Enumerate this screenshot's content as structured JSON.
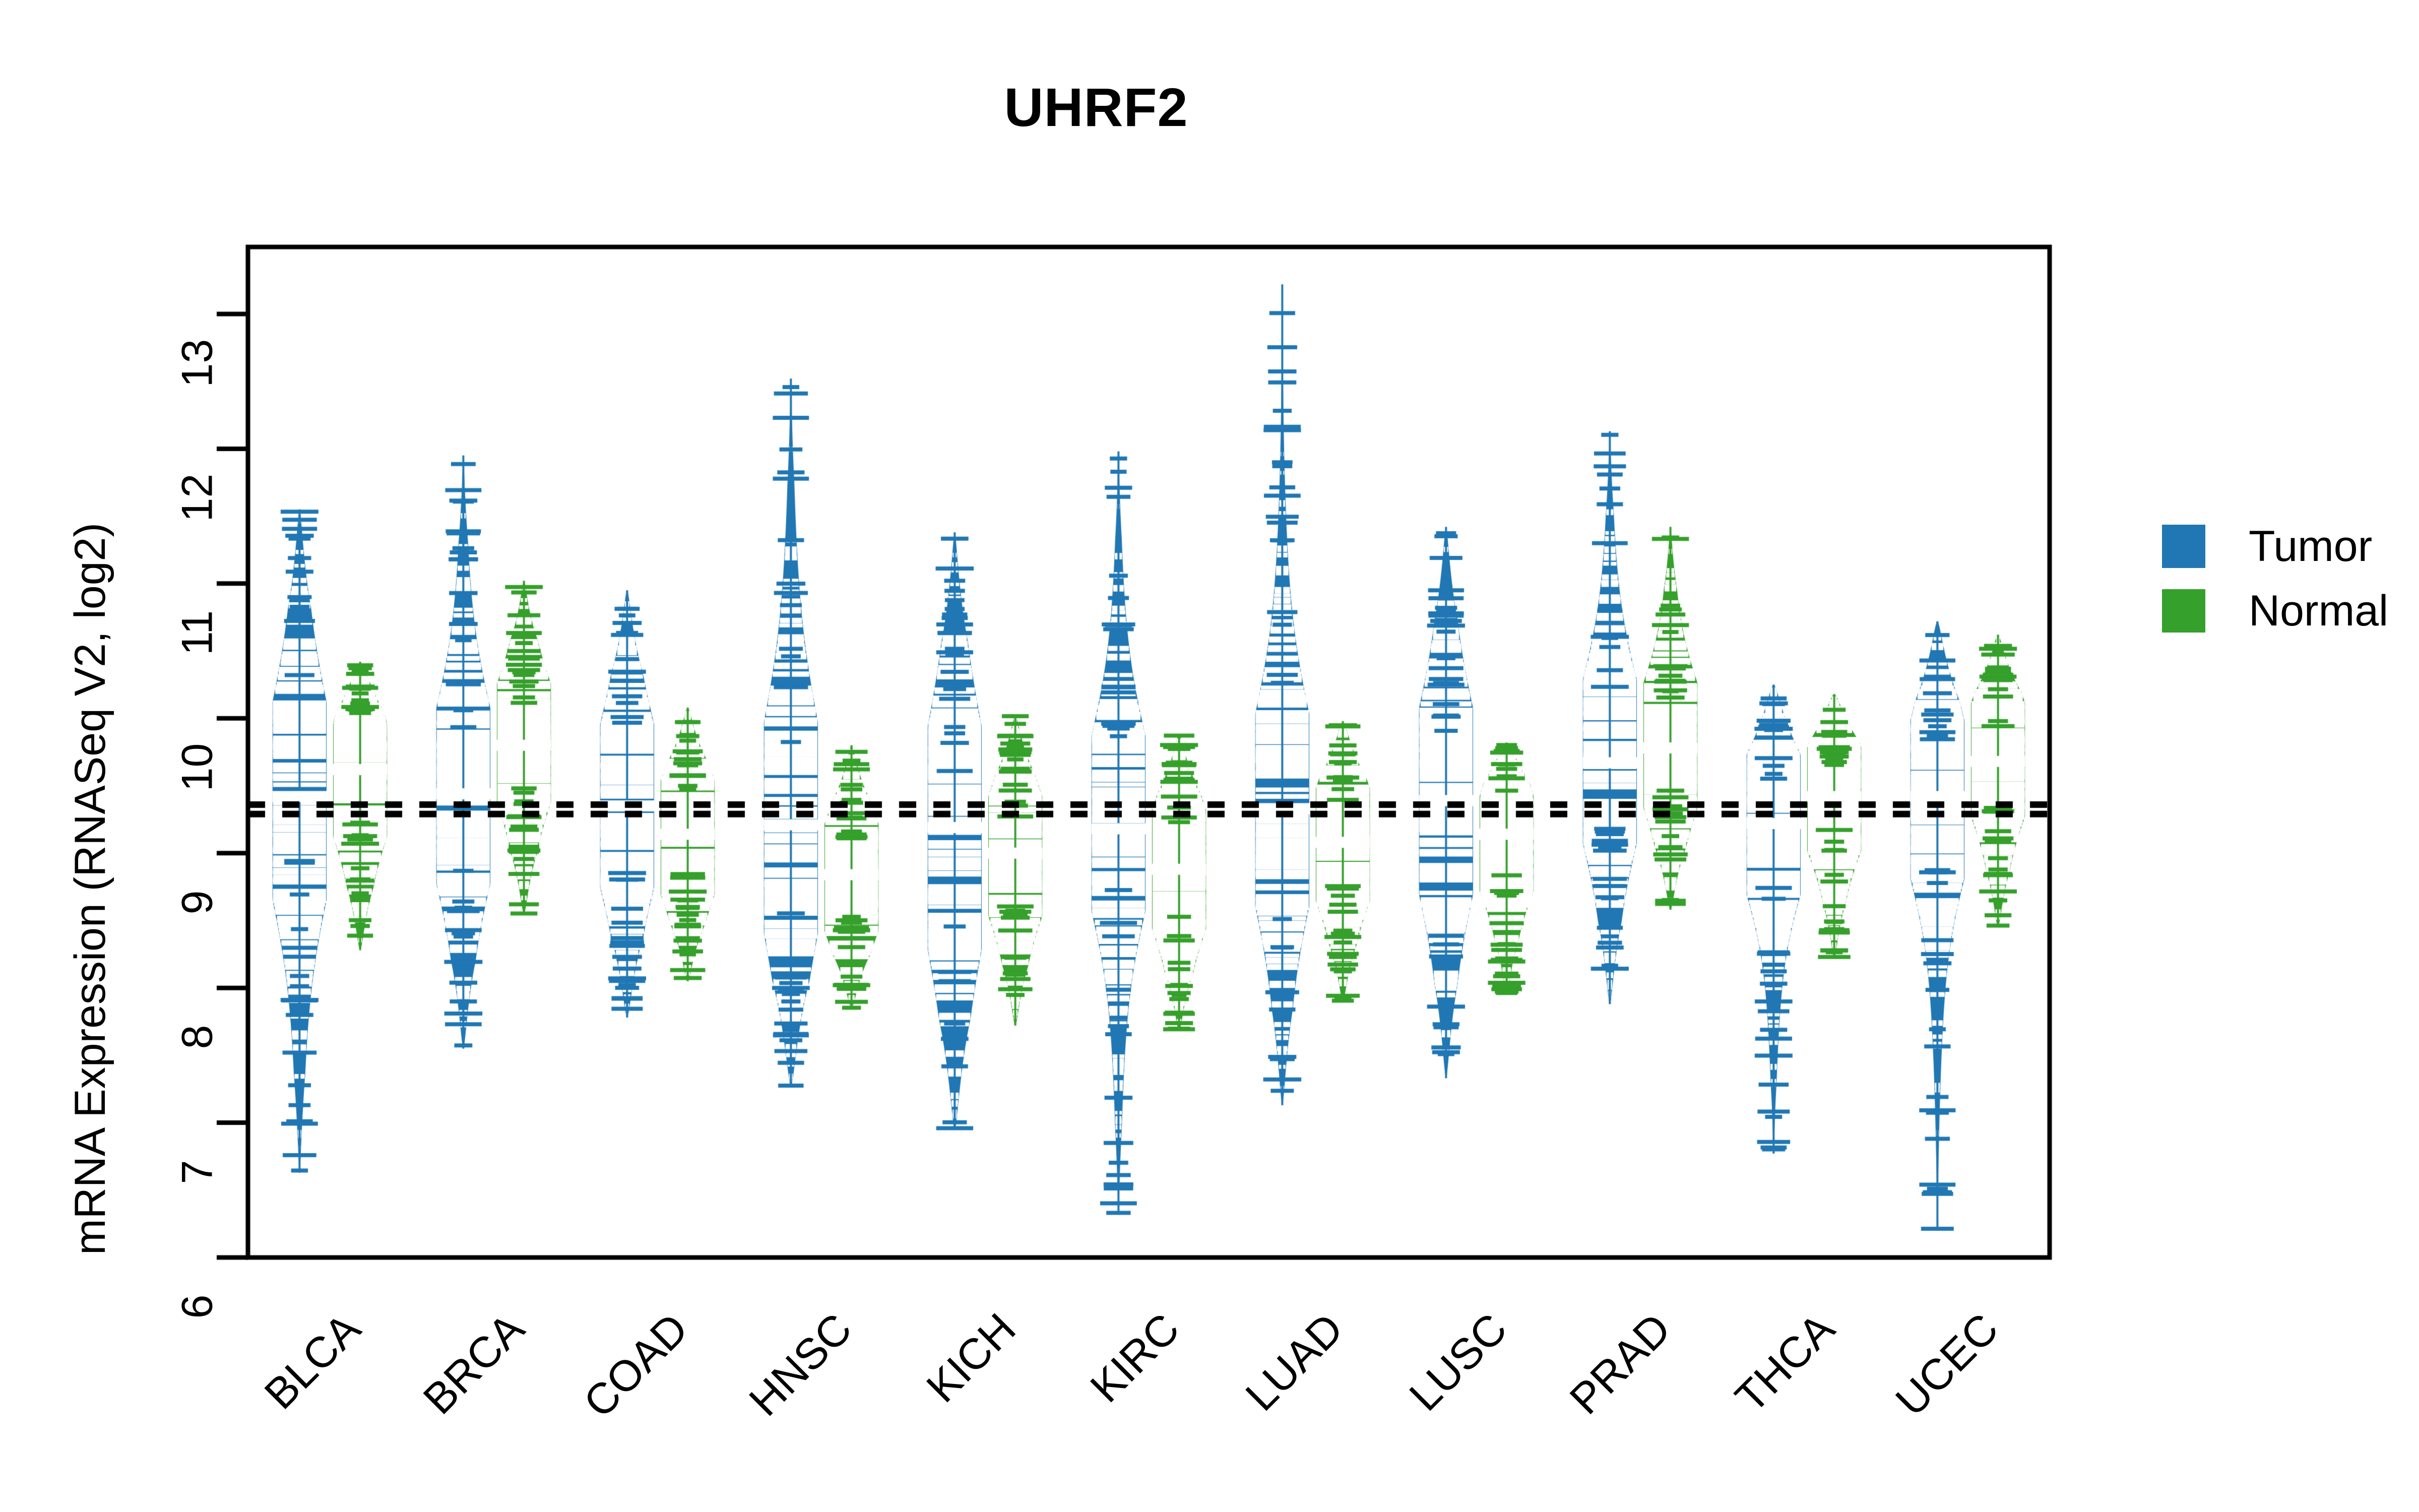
{
  "chart_data": {
    "type": "violin",
    "title": "UHRF2",
    "xlabel": "",
    "ylabel": "mRNA Expression (RNASeq V2, log2)",
    "ylim": [
      6,
      13.45
    ],
    "yticks": [
      6,
      7,
      8,
      9,
      10,
      11,
      12,
      13
    ],
    "ytick_labels": [
      "6",
      "7",
      "8",
      "9",
      "10",
      "11",
      "12",
      "13"
    ],
    "grid": false,
    "legend_position": "right",
    "categories": [
      "BLCA",
      "BRCA",
      "COAD",
      "HNSC",
      "KICH",
      "KIRC",
      "LUAD",
      "LUSC",
      "PRAD",
      "THCA",
      "UCEC"
    ],
    "reference_lines": [
      {
        "value": 9.36,
        "style": "dashed",
        "color": "#000000"
      },
      {
        "value": 9.29,
        "style": "dashed",
        "color": "#000000"
      }
    ],
    "series": [
      {
        "name": "Tumor",
        "color": "#2077b4",
        "stats": [
          {
            "category": "BLCA",
            "median": 9.42,
            "min": 6.63,
            "max": 11.55,
            "q1": 8.95,
            "q3": 9.95,
            "density_center": 9.38,
            "spread": 0.7
          },
          {
            "category": "BRCA",
            "median": 9.44,
            "min": 7.55,
            "max": 11.95,
            "q1": 9.05,
            "q3": 9.9,
            "density_center": 9.42,
            "spread": 0.62
          },
          {
            "category": "COAD",
            "median": 9.35,
            "min": 7.78,
            "max": 10.95,
            "q1": 8.95,
            "q3": 9.8,
            "density_center": 9.35,
            "spread": 0.58
          },
          {
            "category": "HNSC",
            "median": 9.21,
            "min": 7.27,
            "max": 12.52,
            "q1": 8.7,
            "q3": 9.8,
            "density_center": 9.18,
            "spread": 0.75
          },
          {
            "category": "KICH",
            "median": 9.19,
            "min": 6.95,
            "max": 11.38,
            "q1": 8.6,
            "q3": 9.55,
            "density_center": 9.12,
            "spread": 0.78
          },
          {
            "category": "KIRC",
            "median": 9.18,
            "min": 6.32,
            "max": 11.98,
            "q1": 8.8,
            "q3": 9.68,
            "density_center": 9.22,
            "spread": 0.62
          },
          {
            "category": "LUAD",
            "median": 9.33,
            "min": 7.13,
            "max": 13.22,
            "q1": 8.85,
            "q3": 9.8,
            "density_center": 9.32,
            "spread": 0.68
          },
          {
            "category": "LUSC",
            "median": 9.39,
            "min": 7.33,
            "max": 11.42,
            "q1": 8.95,
            "q3": 9.9,
            "density_center": 9.38,
            "spread": 0.66
          },
          {
            "category": "PRAD",
            "median": 9.67,
            "min": 7.88,
            "max": 12.13,
            "q1": 9.25,
            "q3": 10.1,
            "density_center": 9.68,
            "spread": 0.58
          },
          {
            "category": "THCA",
            "median": 9.22,
            "min": 6.77,
            "max": 10.25,
            "q1": 8.85,
            "q3": 9.55,
            "density_center": 9.22,
            "spread": 0.5
          },
          {
            "category": "UCEC",
            "median": 9.42,
            "min": 6.2,
            "max": 10.72,
            "q1": 9.0,
            "q3": 9.78,
            "density_center": 9.4,
            "spread": 0.56
          }
        ]
      },
      {
        "name": "Normal",
        "color": "#35a02b",
        "stats": [
          {
            "category": "BLCA",
            "median": 9.62,
            "min": 8.28,
            "max": 10.42,
            "q1": 9.25,
            "q3": 9.95,
            "density_center": 9.58,
            "spread": 0.44
          },
          {
            "category": "BRCA",
            "median": 9.8,
            "min": 8.55,
            "max": 11.02,
            "q1": 9.5,
            "q3": 10.08,
            "density_center": 9.82,
            "spread": 0.42
          },
          {
            "category": "COAD",
            "median": 9.14,
            "min": 8.05,
            "max": 10.08,
            "q1": 8.85,
            "q3": 9.35,
            "density_center": 9.12,
            "spread": 0.4
          },
          {
            "category": "HNSC",
            "median": 8.84,
            "min": 7.85,
            "max": 9.8,
            "q1": 8.55,
            "q3": 9.1,
            "density_center": 8.82,
            "spread": 0.38
          },
          {
            "category": "KICH",
            "median": 9.0,
            "min": 7.72,
            "max": 10.02,
            "q1": 8.7,
            "q3": 9.25,
            "density_center": 8.98,
            "spread": 0.42
          },
          {
            "category": "KIRC",
            "median": 8.88,
            "min": 7.68,
            "max": 9.88,
            "q1": 8.6,
            "q3": 9.18,
            "density_center": 8.88,
            "spread": 0.42
          },
          {
            "category": "LUAD",
            "median": 9.08,
            "min": 7.9,
            "max": 9.98,
            "q1": 8.8,
            "q3": 9.38,
            "density_center": 9.06,
            "spread": 0.4
          },
          {
            "category": "LUSC",
            "median": 9.14,
            "min": 7.95,
            "max": 9.82,
            "q1": 8.88,
            "q3": 9.38,
            "density_center": 9.12,
            "spread": 0.38
          },
          {
            "category": "PRAD",
            "median": 9.78,
            "min": 8.58,
            "max": 11.42,
            "q1": 9.5,
            "q3": 10.12,
            "density_center": 9.8,
            "spread": 0.44
          },
          {
            "category": "THCA",
            "median": 9.42,
            "min": 8.22,
            "max": 10.18,
            "q1": 9.18,
            "q3": 9.65,
            "density_center": 9.42,
            "spread": 0.38
          },
          {
            "category": "UCEC",
            "median": 9.68,
            "min": 8.45,
            "max": 10.62,
            "q1": 9.4,
            "q3": 9.92,
            "density_center": 9.7,
            "spread": 0.4
          }
        ]
      }
    ]
  },
  "legend": {
    "items": [
      {
        "label": "Tumor",
        "color": "#2077b4"
      },
      {
        "label": "Normal",
        "color": "#35a02b"
      }
    ]
  },
  "axes": {
    "y_title": "mRNA Expression (RNASeq V2, log2)",
    "y_tick_labels": [
      "13",
      "12",
      "11",
      "10",
      "9",
      "8",
      "7",
      "6"
    ],
    "x_tick_labels": [
      "BLCA",
      "BRCA",
      "COAD",
      "HNSC",
      "KICH",
      "KIRC",
      "LUAD",
      "LUSC",
      "PRAD",
      "THCA",
      "UCEC"
    ]
  },
  "title": {
    "text": "UHRF2"
  },
  "colors": {
    "tumor": "#2077b4",
    "normal": "#35a02b",
    "axis": "#000000",
    "background": "#ffffff"
  }
}
